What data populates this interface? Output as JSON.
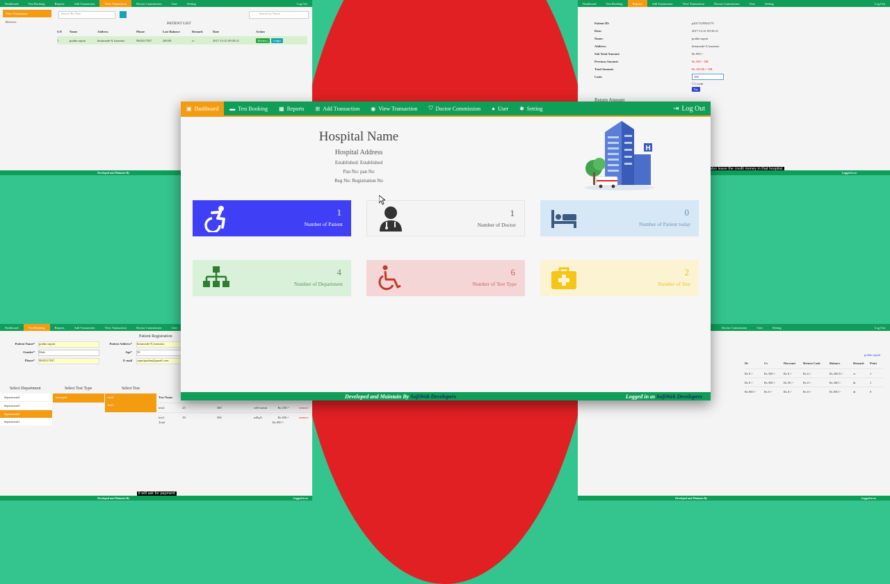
{
  "main": {
    "nav": [
      {
        "label": "Dashboard",
        "icon": "dashboard-icon",
        "active": true
      },
      {
        "label": "Test Booking",
        "icon": "bed-icon"
      },
      {
        "label": "Reports",
        "icon": "calendar-icon"
      },
      {
        "label": "Add Transaction",
        "icon": "plus-square-icon"
      },
      {
        "label": "View Transaction",
        "icon": "eye-icon"
      },
      {
        "label": "Doctor Commission",
        "icon": "shield-icon"
      },
      {
        "label": "User",
        "icon": "user-icon"
      },
      {
        "label": "Setting",
        "icon": "gears-icon"
      }
    ],
    "logout": "Log Out",
    "hospital": {
      "name": "Hospital Name",
      "address": "Hospital Address",
      "established": "Established: Established",
      "pan": "Pan No: pan No",
      "reg": "Reg No: Registration No"
    },
    "cards": [
      {
        "value": "1",
        "label": "Number of Patient",
        "bg": "#3f3ff5",
        "fg": "#ffffff",
        "icon": "wheelchair-active-icon"
      },
      {
        "value": "1",
        "label": "Number of Doctor",
        "bg": "#f4f4f4",
        "fg": "#555555",
        "icon": "doctor-icon"
      },
      {
        "value": "0",
        "label": "Number of Patient today",
        "bg": "#d6e7f6",
        "fg": "#6f8fb8",
        "icon": "bed-patient-icon"
      },
      {
        "value": "4",
        "label": "Number of Department",
        "bg": "#d9f0d9",
        "fg": "#5f8f5f",
        "icon": "sitemap-icon"
      },
      {
        "value": "6",
        "label": "Number of Test Type",
        "bg": "#f5d6d6",
        "fg": "#c86060",
        "icon": "wheelchair-icon"
      },
      {
        "value": "2",
        "label": "Number of Test",
        "bg": "#fbf3d2",
        "fg": "#e8c21c",
        "icon": "medkit-icon"
      }
    ],
    "footer": {
      "dev_prefix": "Developed and Maintain By",
      "dev_name": "SoftWeb Developers",
      "logged_prefix": "Logged in as",
      "logged_name": "SoftWeb Developers"
    }
  },
  "top_left": {
    "nav": [
      "Dashboard",
      "Test Booking",
      "Reports",
      "Add Transaction",
      "View Transaction",
      "Doctor Commission",
      "User",
      "Setting"
    ],
    "active": "View Transaction",
    "logout": "Log Out",
    "sidebar": [
      "View Transaction",
      "Reviews"
    ],
    "search_placeholder": "Search By Date",
    "search2_placeholder": "Search by Name",
    "title": "PATIENT LIST",
    "columns": [
      "S.N",
      "Name",
      "Address",
      "Phone",
      "Last Balance",
      "Remark",
      "Date",
      "Action"
    ],
    "row": [
      "1",
      "prabin sapoti",
      "birtamode-9, kanxeno",
      "9843517037",
      "200.00",
      "cr",
      "2017-12-21 09:30:21"
    ],
    "row_btns": [
      "Reviews",
      "Ledger"
    ],
    "footer": "Developed and Maintain By"
  },
  "top_right": {
    "nav": [
      "Dashboard",
      "Test Booking",
      "Reports",
      "Add Transaction",
      "View Transaction",
      "Doctor Commission",
      "User",
      "Setting"
    ],
    "active": "Reports",
    "logout": "Log Out",
    "fields": [
      {
        "k": "Patient ID:",
        "v": "p2017229502179"
      },
      {
        "k": "Date:",
        "v": "2017-12-21 09:30:21"
      },
      {
        "k": "Name:",
        "v": "prabin sapoti"
      },
      {
        "k": "Address:",
        "v": "birtamode-9, kanxeno"
      },
      {
        "k": "Sub Total Amount:",
        "v": "Rs 950 /-"
      },
      {
        "k": "Previous Amount:",
        "v": "Rs 500 /- DR"
      },
      {
        "k": "Total Amount:",
        "v": "Rs 100.00 /- DR"
      },
      {
        "k": "Cash:",
        "v": "100"
      }
    ],
    "credit": "Credit",
    "pay": "Pay",
    "return_label": "Return Amount",
    "caption": "also leave the credit money in that hospital.",
    "footer_right": "Logged in as"
  },
  "bottom_left": {
    "nav": [
      "Dashboard",
      "Test Booking",
      "Reports",
      "Add Transaction",
      "View Transaction",
      "Doctor Commission",
      "User"
    ],
    "active": "Test Booking",
    "title": "Patient Registration",
    "labels": {
      "name": "Patient Name*",
      "address": "Patient Address*",
      "gender": "Gender*",
      "age": "Age*",
      "phone": "Phone*",
      "email": "E-mail"
    },
    "values": {
      "name": "prabin sapoti",
      "address": "birtamode-9, kanxeno",
      "gender": "Male",
      "age": "50",
      "phone": "9843517037",
      "email": "sapotiprabin@gmail.com"
    },
    "dept_title": "Select Department",
    "departments": [
      "department4",
      "department3",
      "department2",
      "department1"
    ],
    "type_title": "Select Test Type",
    "types": [
      "testtype3"
    ],
    "test_title": "Select Test",
    "tests": [
      "test2",
      "test1"
    ],
    "table_head": "Test Name",
    "rows": [
      [
        "test2",
        "25",
        "300",
        "cell/cumm",
        "Rs 250 /-",
        "remove"
      ],
      [
        "test1",
        "50",
        "500",
        "mEq/L",
        "Rs 600 /-",
        "remove"
      ]
    ],
    "total": [
      "Total",
      "Rs 850 /-"
    ],
    "caption": "it will ask for payment",
    "footer": "Developed and Maintain By",
    "footer_right": "Logged in as"
  },
  "bottom_right": {
    "nav": [
      "Doctor Commission",
      "User",
      "Setting"
    ],
    "logout": "Log Out",
    "name_link": "prabin sapoti",
    "columns": [
      "Dr",
      "Cr",
      "Discount",
      "Return Cash",
      "Balance",
      "Remark",
      "Print"
    ],
    "rows": [
      [
        "Rs 0 /-",
        "Rs 500 /-",
        "Rs 0 /-",
        "Rs 0 /-",
        "Rs 200.0 /-",
        "cr",
        "1"
      ],
      [
        "Rs 0 /-",
        "Rs 500 /-",
        "Rs 50 /-",
        "Rs 0 /-",
        "Rs 300 /-",
        "dr",
        "1"
      ],
      [
        "Rs 850 /-",
        "Rs 0 /-",
        "Rs 0 /-",
        "Rs 0 /-",
        "Rs 850 /-",
        "dr",
        "0"
      ]
    ],
    "footer": "Developed and Maintain By",
    "footer_right": "Logged in as"
  }
}
